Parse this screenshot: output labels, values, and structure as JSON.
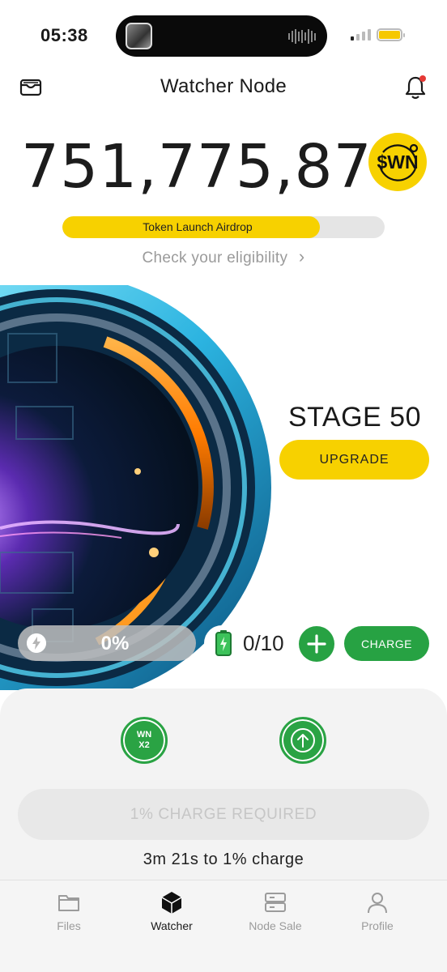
{
  "status_bar": {
    "time": "05:38"
  },
  "header": {
    "title": "Watcher Node"
  },
  "balance": {
    "amount": "751,775,870",
    "token_badge": "$WN"
  },
  "airdrop": {
    "label": "Token Launch Airdrop",
    "progress_fraction": 0.8,
    "link_text": "Check your eligibility",
    "link_chevron": "›"
  },
  "stage": {
    "label": "STAGE 50",
    "upgrade_label": "UPGRADE"
  },
  "charge_row": {
    "energy_percent": "0%",
    "battery_count": "0/10",
    "charge_label": "CHARGE"
  },
  "panel": {
    "boost_line1": "WN",
    "boost_line2": "X2",
    "required_label": "1% CHARGE REQUIRED",
    "timer_text": "3m 21s to 1% charge"
  },
  "tabs": [
    {
      "label": "Files",
      "icon": "folder-icon",
      "active": false
    },
    {
      "label": "Watcher",
      "icon": "cube-icon",
      "active": true
    },
    {
      "label": "Node Sale",
      "icon": "server-icon",
      "active": false
    },
    {
      "label": "Profile",
      "icon": "person-icon",
      "active": false
    }
  ],
  "colors": {
    "accent_yellow": "#f7d100",
    "accent_green": "#27a243",
    "notification_dot": "#e53935"
  }
}
